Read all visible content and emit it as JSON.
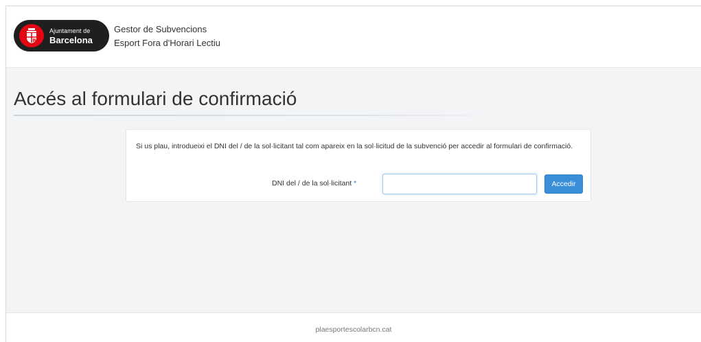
{
  "header": {
    "logo": {
      "line1": "Ajuntament de",
      "line2": "Barcelona",
      "brand_color": "#e30613",
      "icon": "barcelona-crest-icon"
    },
    "app_title": "Gestor de Subvencions",
    "app_subtitle": "Esport Fora d'Horari Lectiu"
  },
  "main": {
    "page_title": "Accés al formulari de confirmació",
    "intro_text": "Si us plau, introdueixi el DNI del / de la sol·licitant tal com apareix en la sol·licitud de la subvenció per accedir al formulari de confirmació.",
    "form": {
      "dni_label": "DNI del / de la sol·licitant",
      "required_marker": "*",
      "dni_value": "",
      "submit_label": "Accedir",
      "accent_color": "#3b8ed8"
    }
  },
  "footer": {
    "site": "plaesportescolarbcn.cat"
  }
}
